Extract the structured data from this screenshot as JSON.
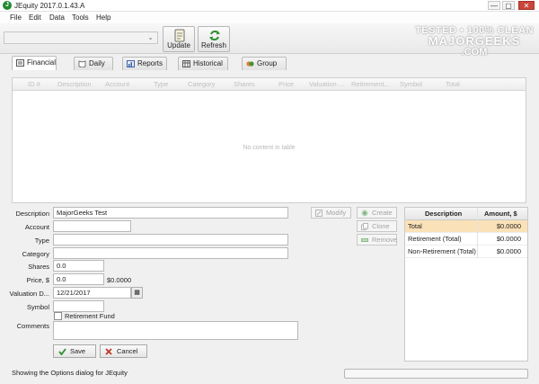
{
  "window": {
    "title": "JEquity 2017.0.1.43.A",
    "app_icon": "J",
    "controls": {
      "minimize": "—",
      "maximize": "▢",
      "close": "✕"
    }
  },
  "menu": [
    "File",
    "Edit",
    "Data",
    "Tools",
    "Help"
  ],
  "toolbar": {
    "selector_value": "",
    "update_label": "Update",
    "refresh_label": "Refresh"
  },
  "watermark": [
    "TESTED • 100% CLEAN",
    "MAJORGEEKS",
    ".COM"
  ],
  "tabs": [
    {
      "label": "Financial",
      "icon": "financial-icon",
      "active": true
    },
    {
      "label": "Daily",
      "icon": "daily-icon",
      "active": false
    },
    {
      "label": "Reports",
      "icon": "reports-icon",
      "active": false
    },
    {
      "label": "Historical",
      "icon": "historical-icon",
      "active": false
    },
    {
      "label": "Group",
      "icon": "group-icon",
      "active": false
    }
  ],
  "table": {
    "columns": [
      "ID #",
      "Description",
      "Account",
      "Type",
      "Category",
      "Shares",
      "Price",
      "Valuation ...",
      "Retirement...",
      "Symbol",
      "Total"
    ],
    "empty_text": "No content in table"
  },
  "form": {
    "description_label": "Description",
    "description_value": "MajorGeeks Test",
    "account_label": "Account",
    "account_value": "",
    "type_label": "Type",
    "type_value": "",
    "category_label": "Category",
    "category_value": "",
    "shares_label": "Shares",
    "shares_value": "0.0",
    "price_label": "Price, $",
    "price_value": "0.0",
    "amount_value": "$0.0000",
    "valuation_label": "Valuation D...",
    "valuation_value": "12/21/2017",
    "symbol_label": "Symbol",
    "symbol_value": "",
    "retirement_label": "Retirement Fund",
    "comments_label": "Comments",
    "comments_value": "",
    "save_label": "Save",
    "cancel_label": "Cancel"
  },
  "actions": {
    "modify_label": "Modify",
    "create_label": "Create",
    "clone_label": "Clone",
    "remove_label": "Remove"
  },
  "summary": {
    "headers": [
      "Description",
      "Amount, $"
    ],
    "rows": [
      {
        "description": "Total",
        "amount": "$0.0000"
      },
      {
        "description": "Retirement (Total)",
        "amount": "$0.0000"
      },
      {
        "description": "Non-Retirement (Total)",
        "amount": "$0.0000"
      }
    ],
    "selected_color": "#fbe1b7"
  },
  "status": {
    "text": "Showing the Options dialog for JEquity"
  }
}
